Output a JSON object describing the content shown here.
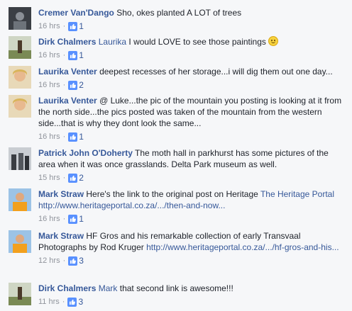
{
  "comments": [
    {
      "author": "Cremer Van'Dango",
      "tag": "",
      "text": "Sho, okes planted A LOT of trees",
      "time": "16 hrs",
      "likes": "1"
    },
    {
      "author": "Dirk Chalmers",
      "tag": "Laurika",
      "text": "I would LOVE to see those paintings",
      "time": "16 hrs",
      "likes": "1"
    },
    {
      "author": "Laurika Venter",
      "tag": "",
      "text": "deepest recesses of her storage...i will dig them out one day...",
      "time": "16 hrs",
      "likes": "2"
    },
    {
      "author": "Laurika Venter",
      "tag": "",
      "text": "@ Luke...the pic of the mountain you posting is looking at it from the north side...the pics posted was taken of the mountain from the western side...that is why they dont look the same...",
      "time": "16 hrs",
      "likes": "1"
    },
    {
      "author": "Patrick John O'Doherty",
      "tag": "",
      "text": "The moth hall in parkhurst has some pictures of the area when it was once grasslands. Delta Park museum as well.",
      "time": "15 hrs",
      "likes": "2"
    },
    {
      "author": "Mark Straw",
      "tag": "",
      "text": "Here's the link to the original post on Heritage",
      "link_label": "The Heritage Portal",
      "url": "http://www.heritageportal.co.za/.../then-and-now...",
      "time": "16 hrs",
      "likes": "1"
    },
    {
      "author": "Mark Straw",
      "tag": "",
      "text": "HF Gros and his remarkable collection of early Transvaal Photographs by Rod Kruger",
      "url": "http://www.heritageportal.co.za/.../hf-gros-and-his...",
      "time": "12 hrs",
      "likes": "3"
    },
    {
      "author": "Dirk Chalmers",
      "tag": "Mark",
      "text": "that second link is awesome!!!",
      "time": "11 hrs",
      "likes": "3"
    }
  ],
  "meta": {
    "separator": "·"
  },
  "colors": {
    "link": "#365899",
    "meta": "#90949c",
    "like_badge": "#5890ff",
    "background": "#f6f7f9"
  },
  "icons": {
    "like": "thumbs-up-icon",
    "emoji": "smiley-emoji-icon"
  }
}
